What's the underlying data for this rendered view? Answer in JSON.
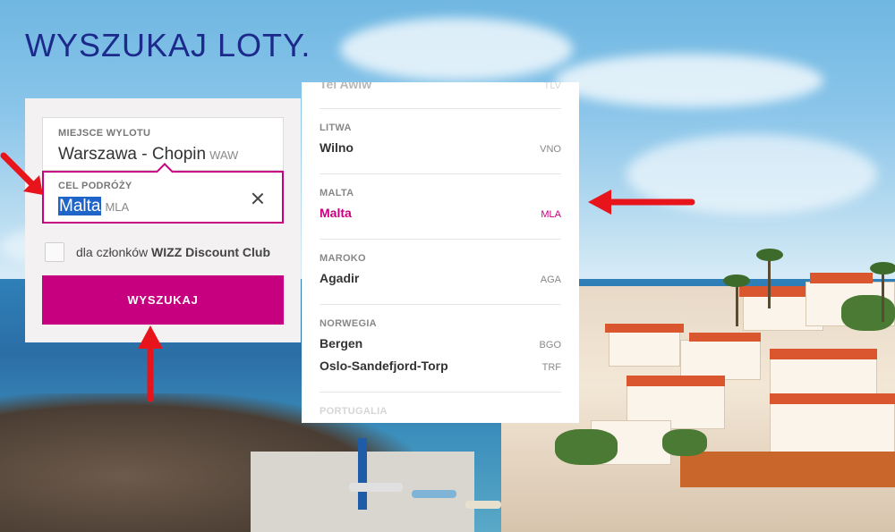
{
  "page": {
    "title": "WYSZUKAJ LOTY."
  },
  "search": {
    "origin_label": "MIEJSCE WYLOTU",
    "origin_value": "Warszawa - Chopin",
    "origin_code": "WAW",
    "destination_label": "CEL PODRÓŻY",
    "destination_value": "Malta",
    "destination_code": "MLA",
    "discount_text_prefix": "dla członków",
    "discount_text_bold": "WIZZ Discount Club",
    "discount_checked": false,
    "search_button": "WYSZUKAJ"
  },
  "dropdown": {
    "partial_top": {
      "city": "Tel Awiw",
      "code": "TLV"
    },
    "groups": [
      {
        "country": "LITWA",
        "items": [
          {
            "city": "Wilno",
            "code": "VNO"
          }
        ]
      },
      {
        "country": "MALTA",
        "items": [
          {
            "city": "Malta",
            "code": "MLA",
            "selected": true
          }
        ]
      },
      {
        "country": "MAROKO",
        "items": [
          {
            "city": "Agadir",
            "code": "AGA"
          }
        ]
      },
      {
        "country": "NORWEGIA",
        "items": [
          {
            "city": "Bergen",
            "code": "BGO"
          },
          {
            "city": "Oslo-Sandefjord-Torp",
            "code": "TRF"
          }
        ]
      }
    ],
    "partial_bottom": {
      "country": "PORTUGALIA"
    }
  },
  "colors": {
    "brand_magenta": "#c6007e",
    "title_blue": "#1c2a8b",
    "annotation_red": "#e8141c"
  },
  "icons": {
    "clear": "close-icon",
    "checkbox": "checkbox-empty"
  }
}
